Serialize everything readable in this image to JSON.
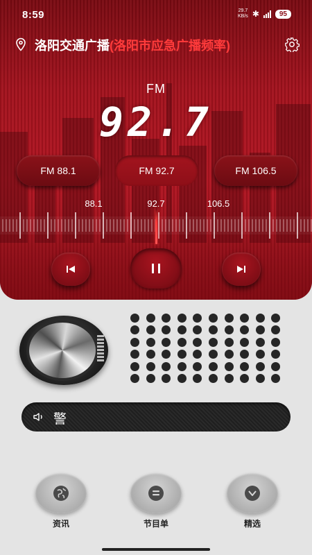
{
  "status_bar": {
    "time": "8:59",
    "net_speed_value": "29.7",
    "net_speed_unit": "KB/s",
    "battery": "95"
  },
  "header": {
    "title": "洛阳交通广播",
    "subtitle": "(洛阳市应急广播频率)"
  },
  "tuner": {
    "band": "FM",
    "frequency": "92.7",
    "presets": [
      "FM 88.1",
      "FM 92.7",
      "FM 106.5"
    ],
    "scale_labels": [
      "88.1",
      "92.7",
      "106.5"
    ]
  },
  "marquee": {
    "text": "\t警"
  },
  "nav": {
    "items": [
      {
        "label": "资讯",
        "icon": "globe-icon"
      },
      {
        "label": "节目单",
        "icon": "list-icon"
      },
      {
        "label": "精选",
        "icon": "heart-icon"
      }
    ]
  },
  "colors": {
    "panel_red": "#a3121d",
    "accent_red": "#ff3b3b",
    "background": "#e4e4e4"
  }
}
